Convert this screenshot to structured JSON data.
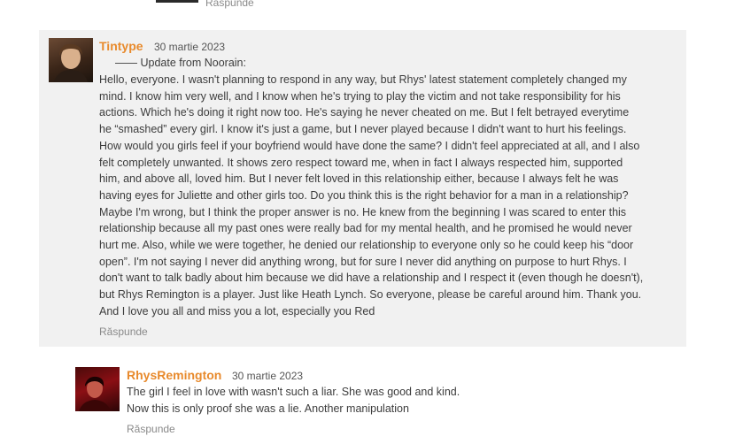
{
  "top_comment": {
    "reply_label": "Răspunde"
  },
  "comment1": {
    "author": "Tintype",
    "date": "30 martie 2023",
    "heading": "—— Update from Noorain:",
    "body": "Hello, everyone. I wasn't planning to respond in any way, but Rhys' latest statement completely changed my\nmind. I know him very well, and I know when he's trying to play the victim and not take responsibility for his\nactions. Which he's doing it right now too. He's saying he never cheated on me. But I felt betrayed everytime\nhe “smashed” every girl. I know it's just a game, but I never played because I didn't want to hurt his feelings.\nHow would you girls feel if your boyfriend would have done the same? I didn't feel appreciated at all, and I also\nfelt completely unwanted. It shows zero respect toward me, when in fact I always respected him, supported\nhim, and above all, loved him. But I never felt loved in this relationship either, because I always felt he was\nhaving eyes for Juliette and other girls too. Do you think this is the right behavior for a man in a relationship?\nMaybe I'm wrong, but I think the proper answer is no. He knew from the beginning I was scared to enter this\nrelationship because all my past ones were really bad for my mental health, and he promised he would never\nhurt me. Also, while we were together, he denied our relationship to everyone only so he could keep his “door\nopen”. I'm not saying I never did anything wrong, but for sure I never did anything on purpose to hurt Rhys. I\ndon't want to talk badly about him because we did have a relationship and I respect it (even though he doesn't),\nbut Rhys Remington is a player. Just like Heath Lynch. So everyone, please be careful around him. Thank you.\nAnd I love you all and miss you a lot, especially you Red",
    "reply_label": "Răspunde"
  },
  "comment2": {
    "author": "RhysRemington",
    "date": "30 martie 2023",
    "body": "The girl I feel in love with wasn't such a liar. She was good and kind.\nNow this is only proof she was a lie. Another manipulation",
    "reply_label": "Răspunde"
  }
}
